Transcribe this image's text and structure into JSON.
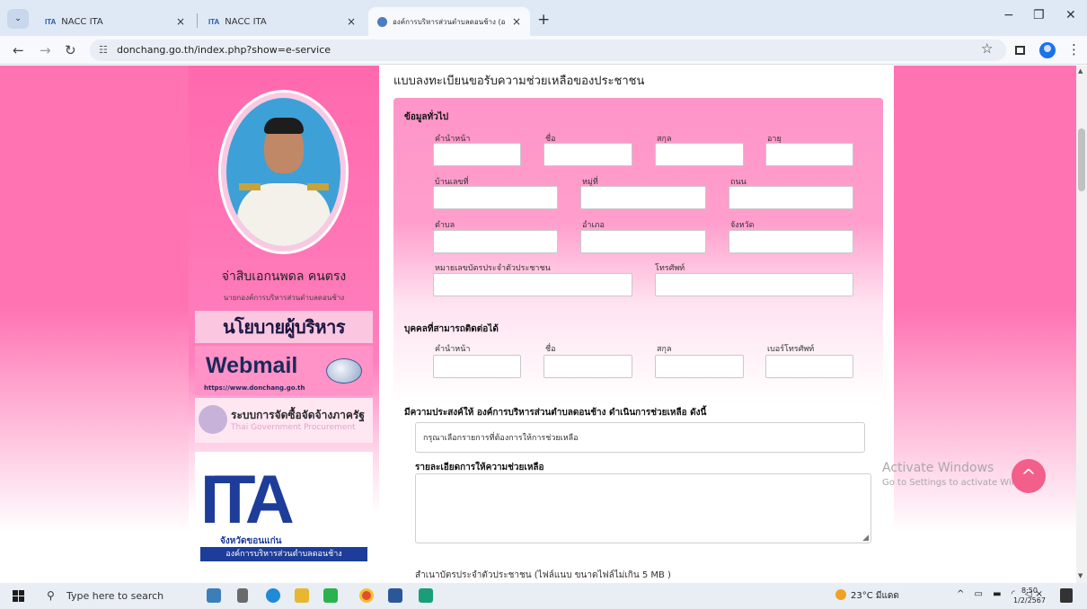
{
  "browser": {
    "tabs": [
      {
        "favicon": "ITA",
        "title": "NACC ITA",
        "active": false
      },
      {
        "favicon": "ITA",
        "title": "NACC ITA",
        "active": false
      },
      {
        "favicon": "globe",
        "title": "องค์การบริหารส่วนตำบลดอนช้าง (อ",
        "active": true
      }
    ],
    "new_tab": "+",
    "close_symbol": "×",
    "url": "donchang.go.th/index.php?show=e-service",
    "window_controls": {
      "minimize": "−",
      "restore": "❐",
      "close": "✕"
    }
  },
  "sidebar": {
    "official_name": "จ่าสิบเอกนพดล คนตรง",
    "official_title": "นายกองค์การบริหารส่วนตำบลดอนช้าง",
    "policy_banner": "นโยบายผู้บริหาร",
    "webmail": {
      "title": "Webmail",
      "url": "https://www.donchang.go.th"
    },
    "procurement": {
      "thai": "ระบบการจัดซื้อจัดจ้างภาครัฐ",
      "english": "Thai Government Procurement"
    },
    "ita": {
      "logo_text": "ITA",
      "province": "จังหวัดขอนแก่น",
      "org": "องค์การบริหารส่วนตำบลดอนช้าง"
    }
  },
  "form": {
    "title": "แบบลงทะเบียนขอรับความช่วยเหลือของประชาชน",
    "general": {
      "heading": "ข้อมูลทั่วไป",
      "labels": {
        "prefix": "คำนำหน้า",
        "first_name": "ชื่อ",
        "last_name": "สกุล",
        "age": "อายุ",
        "house_no": "บ้านเลขที่",
        "moo": "หมู่ที่",
        "road": "ถนน",
        "subdistrict": "ตำบล",
        "district": "อำเภอ",
        "province": "จังหวัด",
        "id_card": "หมายเลขบัตรประจำตัวประชาชน",
        "phone": "โทรศัพท์"
      }
    },
    "contact": {
      "heading": "บุคคลที่สามารถติดต่อได้",
      "labels": {
        "prefix": "คำนำหน้า",
        "first_name": "ชื่อ",
        "last_name": "สกุล",
        "phone": "เบอร์โทรศัพท์"
      }
    },
    "request": {
      "heading": "มีความประสงค์ให้ องค์การบริหารส่วนตำบลดอนช้าง ดำเนินการช่วยเหลือ ดังนี้",
      "select_value": "กรุณาเลือกรายการที่ต้องการให้การช่วยเหลือ"
    },
    "details_heading": "รายละเอียดการให้ความช่วยเหลือ",
    "attachment_label": "สำเนาบัตรประจำตัวประชาชน (ไฟล์แนบ ขนาดไฟล์ไม่เกิน 5 MB )"
  },
  "overlay": {
    "activate_title": "Activate Windows",
    "activate_sub": "Go to Settings to activate Windows.",
    "back_to_top": "^"
  },
  "taskbar": {
    "search_placeholder": "Type here to search",
    "weather": "23°C มีแดด",
    "time": "8:50",
    "date": "1/2/2567"
  },
  "colors": {
    "page_pink": "#ff73b3",
    "panel_pink": "#ff94c8",
    "ita_blue": "#1e3c99",
    "fab": "#f25f8b"
  }
}
